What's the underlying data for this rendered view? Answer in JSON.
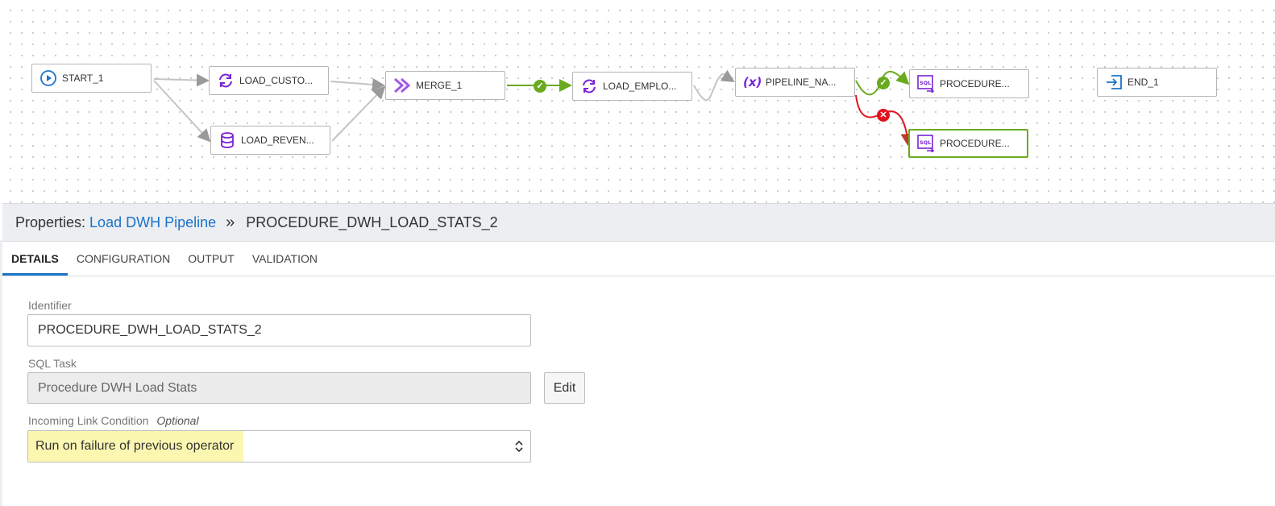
{
  "canvas": {
    "nodes": {
      "start": {
        "label": "START_1",
        "icon": "play-circle-icon"
      },
      "load_customers": {
        "label": "LOAD_CUSTO...",
        "icon": "refresh-icon"
      },
      "load_revenue": {
        "label": "LOAD_REVEN...",
        "icon": "database-icon"
      },
      "merge": {
        "label": "MERGE_1",
        "icon": "merge-icon"
      },
      "load_employees": {
        "label": "LOAD_EMPLO...",
        "icon": "refresh-icon"
      },
      "pipeline_param": {
        "label": "PIPELINE_NA...",
        "icon": "variable-icon"
      },
      "procedure_1": {
        "label": "PROCEDURE...",
        "icon": "sql-icon"
      },
      "procedure_2": {
        "label": "PROCEDURE...",
        "icon": "sql-icon"
      },
      "end": {
        "label": "END_1",
        "icon": "end-arrow-icon"
      }
    },
    "colors": {
      "success": "#6aaa1e",
      "failure": "#e0141e",
      "default_edge": "#bdbdbd",
      "icon": "#7a22d6"
    }
  },
  "properties": {
    "prefix": "Properties:",
    "pipeline_link": "Load DWH Pipeline",
    "separator": "»",
    "selected_name": "PROCEDURE_DWH_LOAD_STATS_2",
    "tabs": [
      "DETAILS",
      "CONFIGURATION",
      "OUTPUT",
      "VALIDATION"
    ],
    "active_tab": "DETAILS",
    "fields": {
      "identifier_label": "Identifier",
      "identifier_value": "PROCEDURE_DWH_LOAD_STATS_2",
      "sql_task_label": "SQL Task",
      "sql_task_value": "Procedure DWH Load Stats",
      "edit_button": "Edit",
      "condition_label": "Incoming Link Condition",
      "condition_optional": "Optional",
      "condition_value": "Run on failure of previous operator"
    }
  }
}
